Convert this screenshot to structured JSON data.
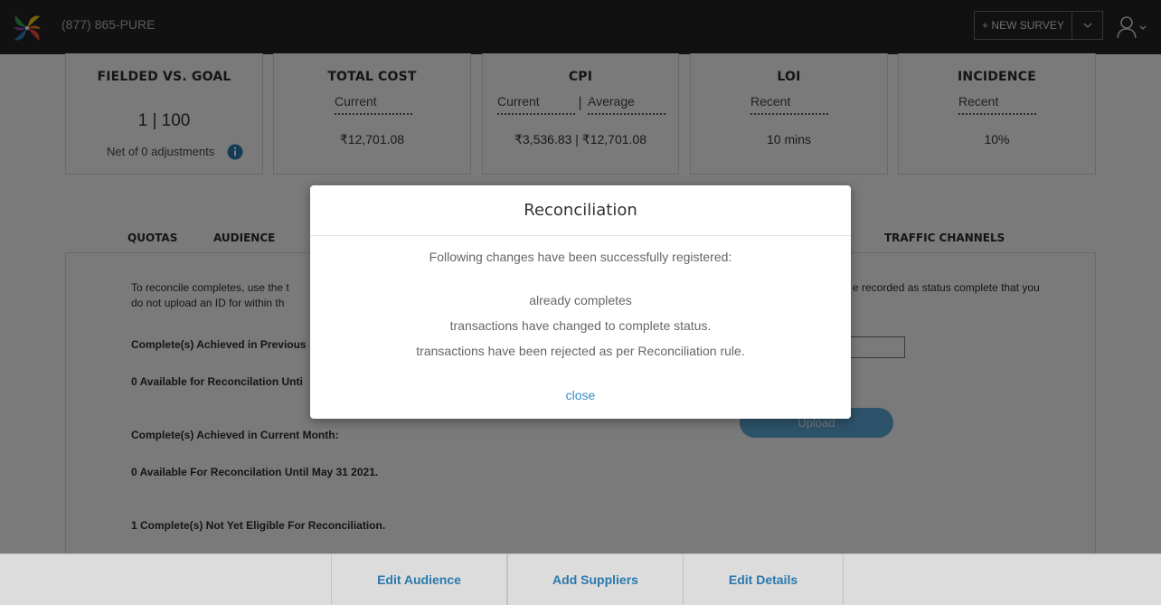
{
  "header": {
    "phone": "(877) 865-PURE",
    "new_survey_label": "+ NEW SURVEY"
  },
  "stats": {
    "fielded": {
      "title": "FIELDED VS. GOAL",
      "value": "1 | 100",
      "note": "Net of 0 adjustments"
    },
    "total_cost": {
      "title": "TOTAL COST",
      "sub": "Current",
      "value": "₹12,701.08"
    },
    "cpi": {
      "title": "CPI",
      "sub_current": "Current",
      "sub_sep": "|",
      "sub_average": "Average",
      "value": "₹3,536.83 | ₹12,701.08"
    },
    "loi": {
      "title": "LOI",
      "sub": "Recent",
      "value": "10 mins"
    },
    "incidence": {
      "title": "INCIDENCE",
      "sub": "Recent",
      "value": "10%"
    }
  },
  "tabs": {
    "quotas": "QUOTAS",
    "audience": "AUDIENCE",
    "traffic": "TRAFFIC CHANNELS"
  },
  "panel": {
    "intro_left_1": "To reconcile completes, use the t",
    "intro_right_1": "e recorded as status complete that you",
    "intro_left_2": "do not upload an ID for within th",
    "prev_month": "Complete(s) Achieved in Previous",
    "prev_available": "0 Available for Reconcilation Unti",
    "curr_month": "Complete(s) Achieved in Current Month:",
    "curr_available": "0 Available For Reconcilation Until May 31 2021.",
    "not_eligible": "1 Complete(s) Not Yet Eligible For Reconciliation.",
    "upload_label": "Upload"
  },
  "footer": {
    "edit_audience": "Edit Audience",
    "add_suppliers": "Add Suppliers",
    "edit_details": "Edit Details"
  },
  "modal": {
    "title": "Reconciliation",
    "message": "Following changes have been successfully registered:",
    "line1": "already completes",
    "line2": "transactions have changed to complete status.",
    "line3": "transactions have been rejected as per Reconciliation rule.",
    "close_label": "close"
  },
  "colors": {
    "topbar": "#222222",
    "link": "#3a8cc4",
    "upload": "#5aa6d6",
    "info_icon": "#2a79ad"
  },
  "icons": {
    "logo": "pinwheel-logo",
    "dropdown": "chevron-down-icon",
    "user": "user-icon",
    "info": "info-icon"
  }
}
